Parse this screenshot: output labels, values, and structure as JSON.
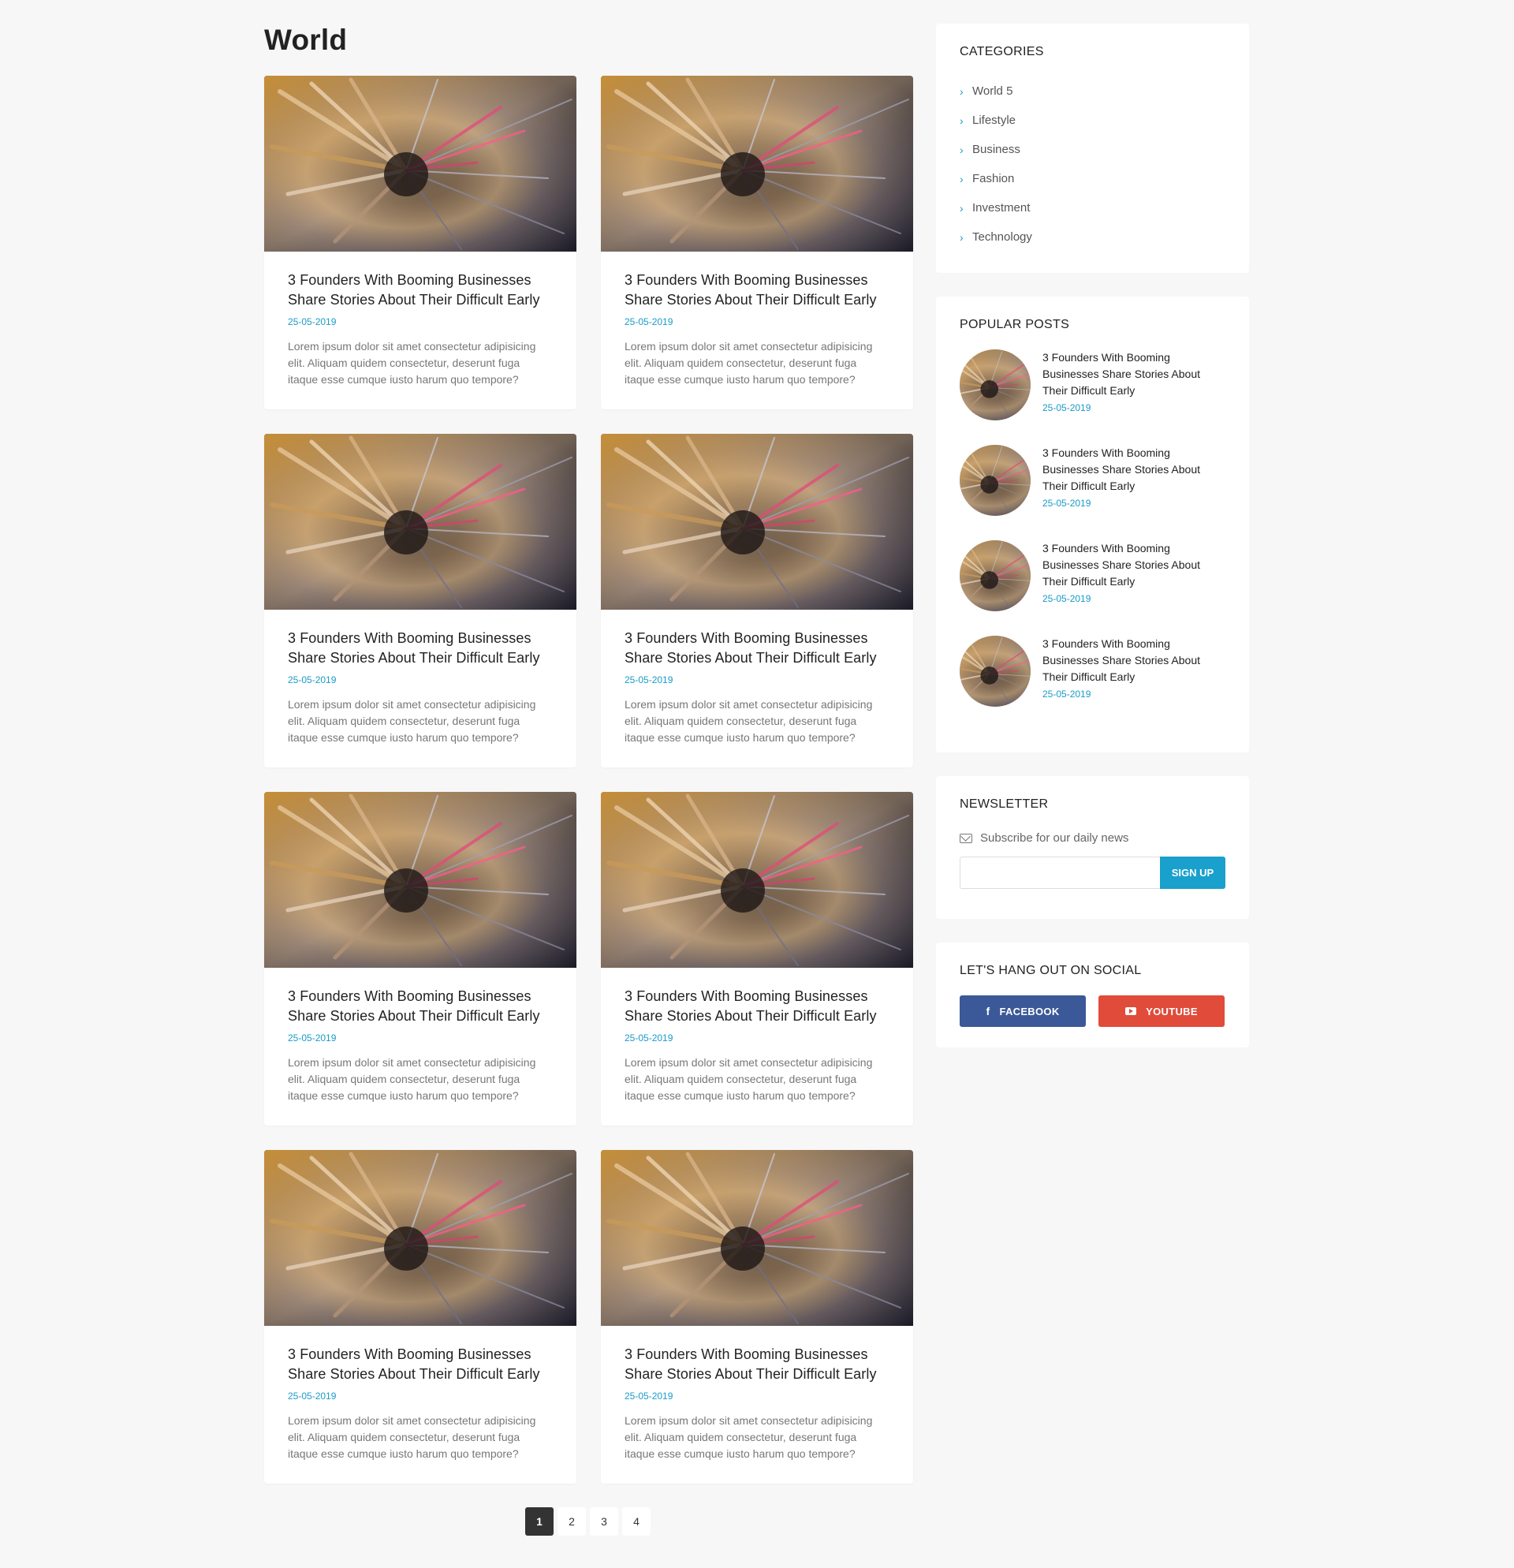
{
  "page": {
    "title": "World"
  },
  "posts": [
    {
      "title": "3 Founders With Booming Businesses Share Stories About Their Difficult Early",
      "date": "25-05-2019",
      "excerpt": "Lorem ipsum dolor sit amet consectetur adipisicing elit. Aliquam quidem consectetur, deserunt fuga itaque esse cumque iusto harum quo tempore?"
    },
    {
      "title": "3 Founders With Booming Businesses Share Stories About Their Difficult Early",
      "date": "25-05-2019",
      "excerpt": "Lorem ipsum dolor sit amet consectetur adipisicing elit. Aliquam quidem consectetur, deserunt fuga itaque esse cumque iusto harum quo tempore?"
    },
    {
      "title": "3 Founders With Booming Businesses Share Stories About Their Difficult Early",
      "date": "25-05-2019",
      "excerpt": "Lorem ipsum dolor sit amet consectetur adipisicing elit. Aliquam quidem consectetur, deserunt fuga itaque esse cumque iusto harum quo tempore?"
    },
    {
      "title": "3 Founders With Booming Businesses Share Stories About Their Difficult Early",
      "date": "25-05-2019",
      "excerpt": "Lorem ipsum dolor sit amet consectetur adipisicing elit. Aliquam quidem consectetur, deserunt fuga itaque esse cumque iusto harum quo tempore?"
    },
    {
      "title": "3 Founders With Booming Businesses Share Stories About Their Difficult Early",
      "date": "25-05-2019",
      "excerpt": "Lorem ipsum dolor sit amet consectetur adipisicing elit. Aliquam quidem consectetur, deserunt fuga itaque esse cumque iusto harum quo tempore?"
    },
    {
      "title": "3 Founders With Booming Businesses Share Stories About Their Difficult Early",
      "date": "25-05-2019",
      "excerpt": "Lorem ipsum dolor sit amet consectetur adipisicing elit. Aliquam quidem consectetur, deserunt fuga itaque esse cumque iusto harum quo tempore?"
    },
    {
      "title": "3 Founders With Booming Businesses Share Stories About Their Difficult Early",
      "date": "25-05-2019",
      "excerpt": "Lorem ipsum dolor sit amet consectetur adipisicing elit. Aliquam quidem consectetur, deserunt fuga itaque esse cumque iusto harum quo tempore?"
    },
    {
      "title": "3 Founders With Booming Businesses Share Stories About Their Difficult Early",
      "date": "25-05-2019",
      "excerpt": "Lorem ipsum dolor sit amet consectetur adipisicing elit. Aliquam quidem consectetur, deserunt fuga itaque esse cumque iusto harum quo tempore?"
    }
  ],
  "pagination": {
    "pages": [
      "1",
      "2",
      "3",
      "4"
    ],
    "active": "1"
  },
  "sidebar": {
    "categories": {
      "title": "CATEGORIES",
      "items": [
        "World 5",
        "Lifestyle",
        "Business",
        "Fashion",
        "Investment",
        "Technology"
      ]
    },
    "popular": {
      "title": "POPULAR POSTS",
      "items": [
        {
          "title": "3 Founders With Booming Businesses Share Stories About Their Difficult Early",
          "date": "25-05-2019"
        },
        {
          "title": "3 Founders With Booming Businesses Share Stories About Their Difficult Early",
          "date": "25-05-2019"
        },
        {
          "title": "3 Founders With Booming Businesses Share Stories About Their Difficult Early",
          "date": "25-05-2019"
        },
        {
          "title": "3 Founders With Booming Businesses Share Stories About Their Difficult Early",
          "date": "25-05-2019"
        }
      ]
    },
    "newsletter": {
      "title": "NEWSLETTER",
      "subtitle": "Subscribe for our daily news",
      "input_placeholder": "",
      "button_label": "SIGN UP"
    },
    "social": {
      "title": "LET'S HANG OUT ON SOCIAL",
      "facebook_label": "FACEBOOK",
      "youtube_label": "YOUTUBE",
      "colors": {
        "facebook": "#3b5998",
        "youtube": "#e04b3a"
      }
    }
  },
  "colors": {
    "accent": "#1a9bc9",
    "background": "#f7f7f7"
  }
}
